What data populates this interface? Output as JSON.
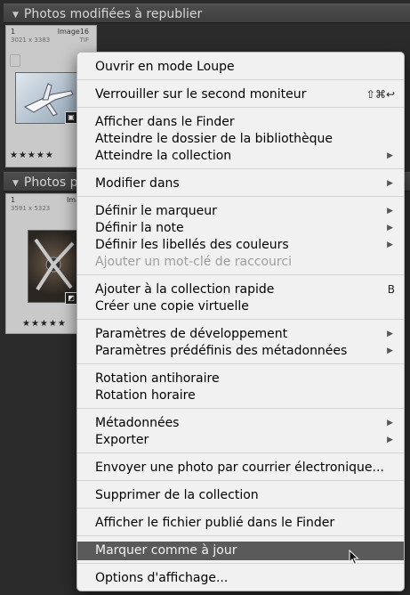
{
  "panels": [
    {
      "header": "Photos modifiées à republier",
      "cell": {
        "number": "1",
        "name": "Image16",
        "dims": "3021 x 3383",
        "ext": "TIF",
        "stars": "★★★★★"
      }
    },
    {
      "header": "Photos p",
      "cell": {
        "number": "1",
        "name": "Image",
        "dims": "3591 x 5323",
        "stars": "★★★★★"
      }
    }
  ],
  "menu": {
    "items": [
      {
        "label": "Ouvrir en mode Loupe"
      },
      {
        "label": "Verrouiller sur le second moniteur",
        "shortcut": "⇧⌘↩"
      },
      {
        "label": "Afficher dans le Finder"
      },
      {
        "label": "Atteindre le dossier de la bibliothèque"
      },
      {
        "label": "Atteindre la collection",
        "submenu": true
      },
      {
        "label": "Modifier dans",
        "submenu": true
      },
      {
        "label": "Définir le marqueur",
        "submenu": true
      },
      {
        "label": "Définir la note",
        "submenu": true
      },
      {
        "label": "Définir les libellés des couleurs",
        "submenu": true
      },
      {
        "label": "Ajouter un mot-clé de raccourci",
        "disabled": true
      },
      {
        "label": "Ajouter à la collection rapide",
        "shortcut": "B"
      },
      {
        "label": "Créer une copie virtuelle"
      },
      {
        "label": "Paramètres de développement",
        "submenu": true
      },
      {
        "label": "Paramètres prédéfinis des métadonnées",
        "submenu": true
      },
      {
        "label": "Rotation antihoraire"
      },
      {
        "label": "Rotation horaire"
      },
      {
        "label": "Métadonnées",
        "submenu": true
      },
      {
        "label": "Exporter",
        "submenu": true
      },
      {
        "label": "Envoyer une photo par courrier électronique..."
      },
      {
        "label": "Supprimer de la collection"
      },
      {
        "label": "Afficher le fichier publié dans le Finder"
      },
      {
        "label": "Marquer comme à jour",
        "highlighted": true
      },
      {
        "label": "Options d'affichage..."
      }
    ]
  },
  "colors": {
    "menu_bg": "#f1f1f1",
    "highlight": "#5a5a5a",
    "panel_bg": "#2b2b2b"
  }
}
